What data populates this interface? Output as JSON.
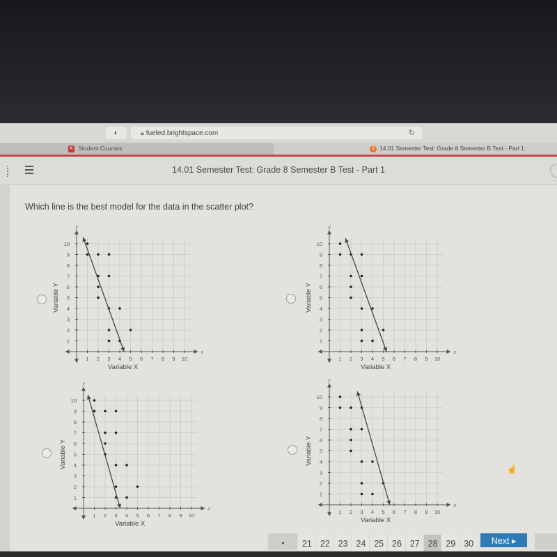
{
  "browser": {
    "url": "fueled.brightspace.com",
    "tabs": [
      {
        "label": "Student Courses",
        "favicon": "K"
      },
      {
        "label": "14.01 Semester Test: Grade 8 Semester B Test - Part 1",
        "favicon": "3"
      }
    ]
  },
  "header": {
    "title": "14.01 Semester Test: Grade 8 Semester B Test - Part 1"
  },
  "question": {
    "text": "Which line is the best model for the data in the scatter plot?"
  },
  "colors": {
    "accent_red": "#c9454a",
    "next_button": "#2e7bb8",
    "current_page_bg": "#c4c3c0"
  },
  "chart_data": [
    {
      "type": "scatter",
      "option": "A",
      "xlabel": "Variable X",
      "ylabel": "Variable Y",
      "x_axis_letter": "x",
      "y_axis_letter": "y",
      "xlim": [
        0,
        10
      ],
      "ylim": [
        0,
        10
      ],
      "xticks": [
        1,
        2,
        3,
        4,
        5,
        6,
        7,
        8,
        9,
        10
      ],
      "yticks": [
        1,
        2,
        3,
        4,
        5,
        6,
        7,
        8,
        9,
        10
      ],
      "grid": true,
      "points": [
        [
          1,
          10
        ],
        [
          1,
          9
        ],
        [
          2,
          9
        ],
        [
          3,
          9
        ],
        [
          2,
          7
        ],
        [
          3,
          7
        ],
        [
          2,
          6
        ],
        [
          2,
          5
        ],
        [
          3,
          4
        ],
        [
          4,
          4
        ],
        [
          3,
          2
        ],
        [
          5,
          2
        ],
        [
          3,
          1
        ],
        [
          4,
          1
        ]
      ],
      "line": {
        "from": [
          0.6,
          10.6
        ],
        "to": [
          4.4,
          0
        ]
      }
    },
    {
      "type": "scatter",
      "option": "B",
      "xlabel": "Variable X",
      "ylabel": "Variable Y",
      "x_axis_letter": "x",
      "y_axis_letter": "y",
      "xlim": [
        0,
        10
      ],
      "ylim": [
        0,
        10
      ],
      "xticks": [
        1,
        2,
        3,
        4,
        5,
        6,
        7,
        8,
        9,
        10
      ],
      "yticks": [
        1,
        2,
        3,
        4,
        5,
        6,
        7,
        8,
        9,
        10
      ],
      "grid": true,
      "points": [
        [
          1,
          10
        ],
        [
          1,
          9
        ],
        [
          2,
          9
        ],
        [
          3,
          9
        ],
        [
          2,
          7
        ],
        [
          3,
          7
        ],
        [
          2,
          6
        ],
        [
          2,
          5
        ],
        [
          3,
          4
        ],
        [
          4,
          4
        ],
        [
          3,
          2
        ],
        [
          5,
          2
        ],
        [
          3,
          1
        ],
        [
          4,
          1
        ]
      ],
      "line": {
        "from": [
          1.5,
          10.5
        ],
        "to": [
          5.3,
          0
        ]
      }
    },
    {
      "type": "scatter",
      "option": "C",
      "xlabel": "Variable X",
      "ylabel": "Variable Y",
      "x_axis_letter": "x",
      "y_axis_letter": "y",
      "xlim": [
        0,
        10
      ],
      "ylim": [
        0,
        10
      ],
      "xticks": [
        1,
        2,
        3,
        4,
        5,
        6,
        7,
        8,
        9,
        10
      ],
      "yticks": [
        1,
        2,
        3,
        4,
        5,
        6,
        7,
        8,
        9,
        10
      ],
      "grid": true,
      "points": [
        [
          1,
          10
        ],
        [
          1,
          9
        ],
        [
          2,
          9
        ],
        [
          3,
          9
        ],
        [
          2,
          7
        ],
        [
          3,
          7
        ],
        [
          2,
          6
        ],
        [
          2,
          5
        ],
        [
          3,
          4
        ],
        [
          4,
          4
        ],
        [
          3,
          2
        ],
        [
          5,
          2
        ],
        [
          3,
          1
        ],
        [
          4,
          1
        ]
      ],
      "line": {
        "from": [
          0.4,
          10.5
        ],
        "to": [
          3.4,
          0
        ]
      }
    },
    {
      "type": "scatter",
      "option": "D",
      "xlabel": "Variable X",
      "ylabel": "Variable Y",
      "x_axis_letter": "x",
      "y_axis_letter": "y",
      "xlim": [
        0,
        10
      ],
      "ylim": [
        0,
        10
      ],
      "xticks": [
        1,
        2,
        3,
        4,
        5,
        6,
        7,
        8,
        9,
        10
      ],
      "yticks": [
        1,
        2,
        3,
        4,
        5,
        6,
        7,
        8,
        9,
        10
      ],
      "grid": true,
      "points": [
        [
          1,
          10
        ],
        [
          1,
          9
        ],
        [
          2,
          9
        ],
        [
          3,
          9
        ],
        [
          2,
          7
        ],
        [
          3,
          7
        ],
        [
          2,
          6
        ],
        [
          2,
          5
        ],
        [
          3,
          4
        ],
        [
          4,
          4
        ],
        [
          3,
          2
        ],
        [
          5,
          2
        ],
        [
          3,
          1
        ],
        [
          4,
          1
        ]
      ],
      "line": {
        "from": [
          2.6,
          10.5
        ],
        "to": [
          5.6,
          0
        ]
      }
    }
  ],
  "pagination": {
    "prev_icon": "◂",
    "pages": [
      "21",
      "22",
      "23",
      "24",
      "25",
      "26",
      "27",
      "28",
      "29",
      "30"
    ],
    "current": "28",
    "next_label": "Next ▸"
  }
}
